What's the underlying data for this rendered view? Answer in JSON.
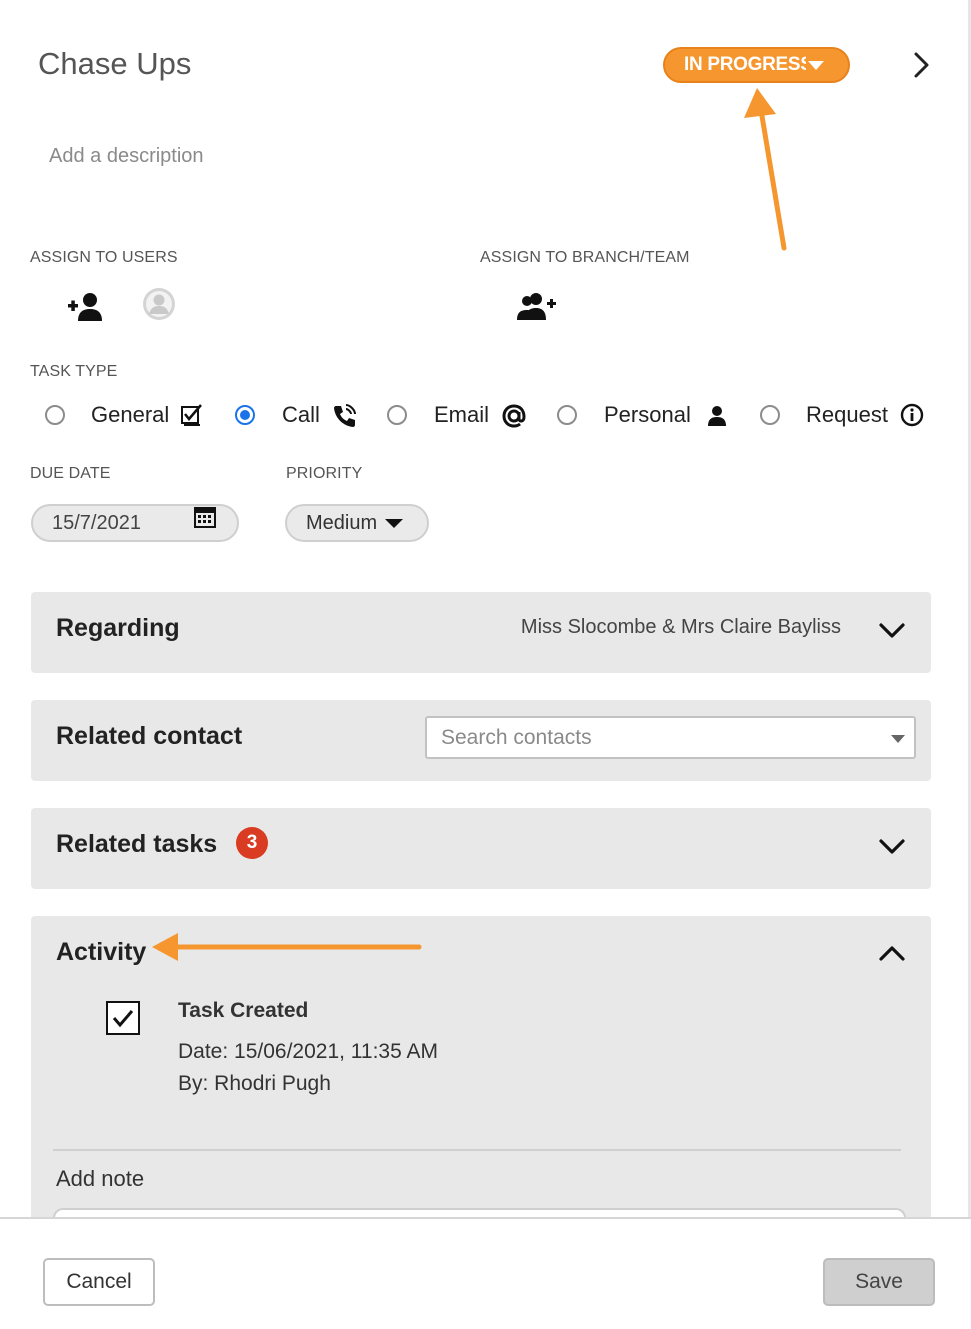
{
  "header": {
    "title": "Chase Ups",
    "status": "IN PROGRESS",
    "status_color": "#f6962f"
  },
  "description": {
    "placeholder": "Add a description"
  },
  "assign": {
    "users_label": "ASSIGN TO USERS",
    "team_label": "ASSIGN TO BRANCH/TEAM"
  },
  "task_type": {
    "label": "TASK TYPE",
    "selected": "Call",
    "options": [
      {
        "label": "General",
        "icon": "checklist-icon"
      },
      {
        "label": "Call",
        "icon": "phone-icon"
      },
      {
        "label": "Email",
        "icon": "at-icon"
      },
      {
        "label": "Personal",
        "icon": "person-icon"
      },
      {
        "label": "Request",
        "icon": "info-icon"
      }
    ]
  },
  "due_date": {
    "label": "DUE DATE",
    "value": "15/7/2021"
  },
  "priority": {
    "label": "PRIORITY",
    "value": "Medium"
  },
  "regarding": {
    "title": "Regarding",
    "value": "Miss Slocombe & Mrs Claire Bayliss"
  },
  "related_contact": {
    "title": "Related contact",
    "placeholder": "Search contacts"
  },
  "related_tasks": {
    "title": "Related tasks",
    "count": "3"
  },
  "activity": {
    "title": "Activity",
    "entries": [
      {
        "title": "Task Created",
        "date": "Date: 15/06/2021, 11:35 AM",
        "by": "By: Rhodri Pugh"
      }
    ],
    "add_note_label": "Add note"
  },
  "footer": {
    "cancel_label": "Cancel",
    "save_label": "Save"
  },
  "annotation_color": "#f6962f"
}
